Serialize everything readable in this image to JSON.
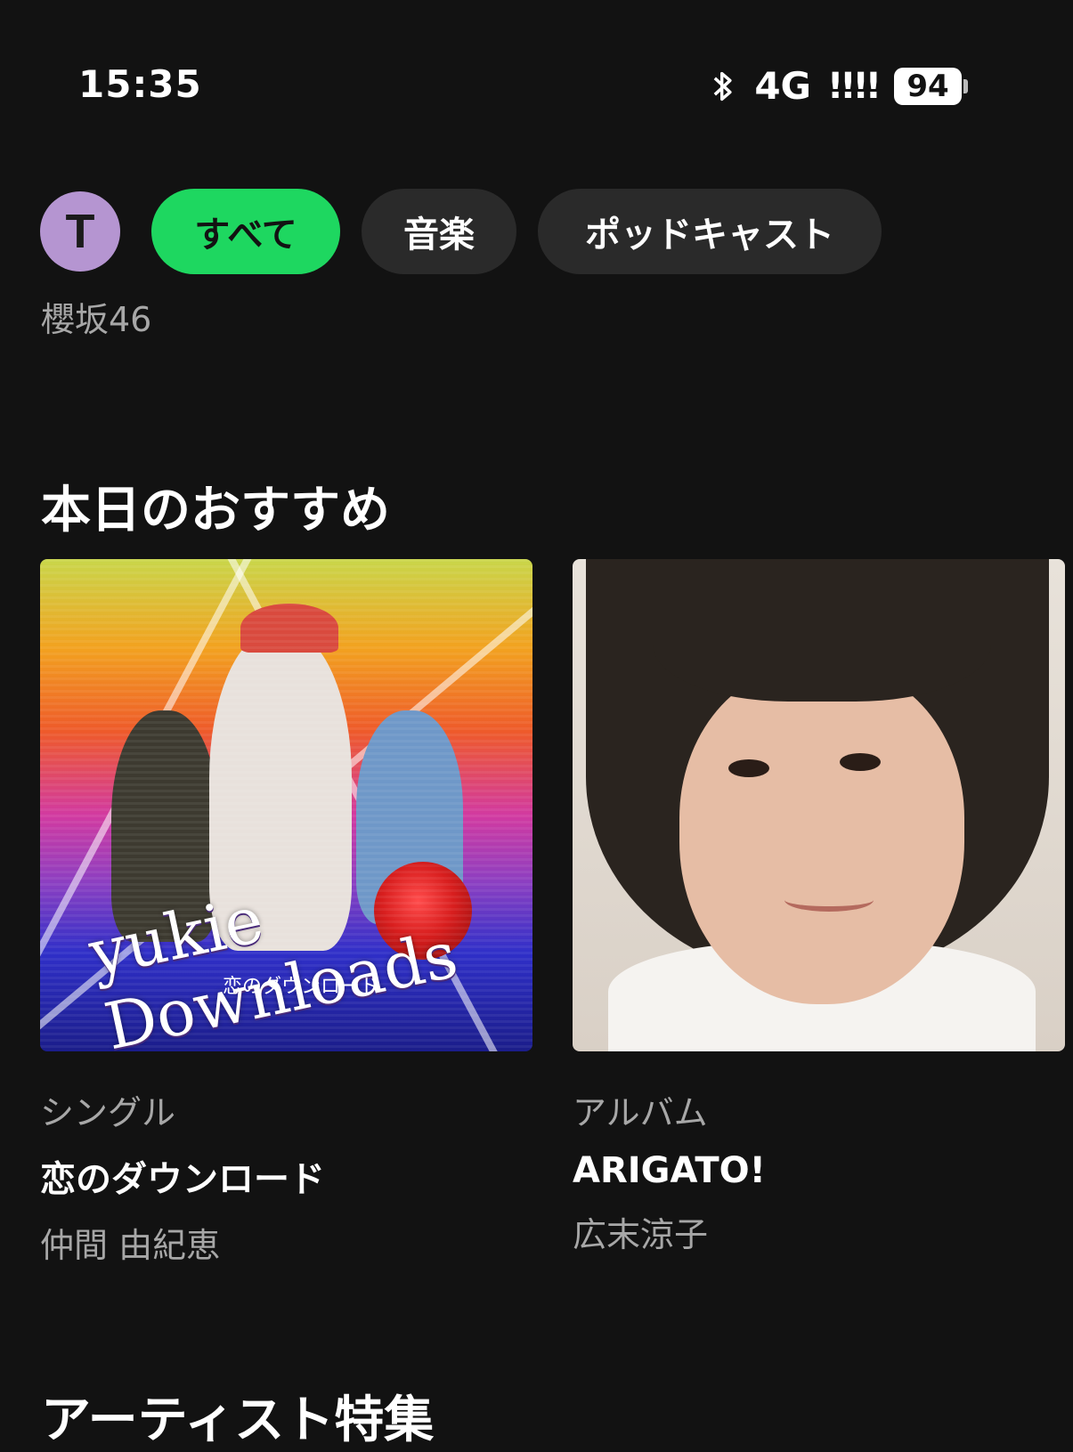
{
  "status_bar": {
    "time": "15:35",
    "network": "4G",
    "signal": "!!!!",
    "battery": "94"
  },
  "profile": {
    "initial": "T"
  },
  "filters": {
    "all": "すべて",
    "music": "音楽",
    "podcasts": "ポッドキャスト"
  },
  "subtitle": "櫻坂46",
  "recommend_section": {
    "title": "本日のおすすめ",
    "items": [
      {
        "type": "シングル",
        "title": "恋のダウンロード",
        "artist": "仲間 由紀恵",
        "cover_text": "yukie Downloads",
        "cover_subtext": "恋のダウンロード"
      },
      {
        "type": "アルバム",
        "title": "ARIGATO!",
        "artist": "広末涼子"
      }
    ]
  },
  "next_section": {
    "title": "アーティスト特集"
  },
  "colors": {
    "background": "#121212",
    "accent": "#1ed760",
    "chip": "#2a2a2a",
    "avatar": "#b595d1",
    "muted_text": "#a7a7a7"
  }
}
